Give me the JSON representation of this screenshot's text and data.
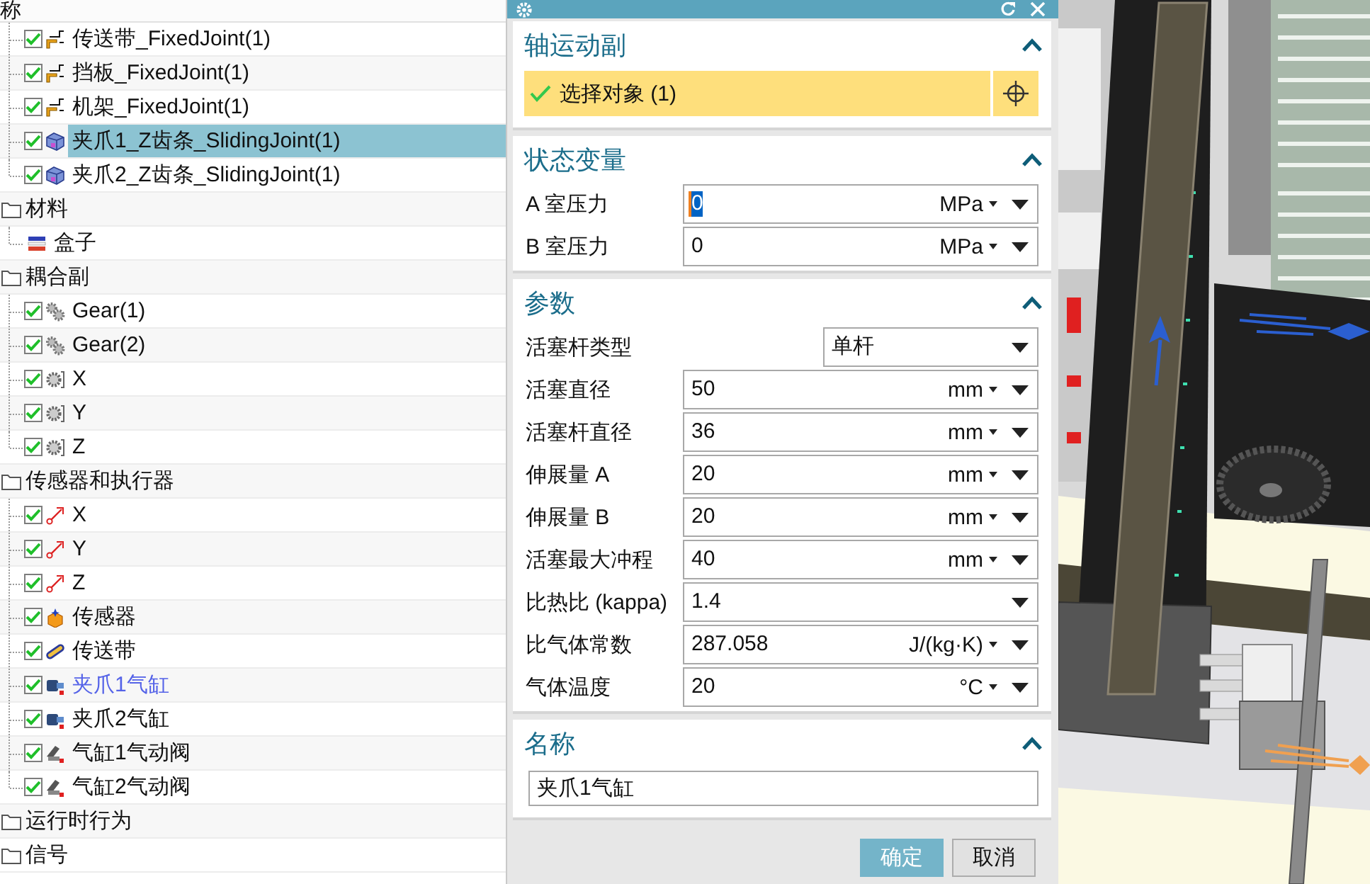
{
  "tree": {
    "column_header": "称",
    "nodes": [
      {
        "children": [
          {
            "label": "传送带_FixedJoint(1)",
            "kind": "fixed-joint",
            "checked": true,
            "selected": false,
            "editing": false
          },
          {
            "label": "挡板_FixedJoint(1)",
            "kind": "fixed-joint",
            "checked": true,
            "selected": false,
            "editing": false
          },
          {
            "label": "机架_FixedJoint(1)",
            "kind": "fixed-joint",
            "checked": true,
            "selected": false,
            "editing": false
          },
          {
            "label": "夹爪1_Z齿条_SlidingJoint(1)",
            "kind": "sliding-joint",
            "checked": true,
            "selected": true,
            "editing": false
          },
          {
            "label": "夹爪2_Z齿条_SlidingJoint(1)",
            "kind": "sliding-joint",
            "checked": true,
            "selected": false,
            "editing": false
          }
        ]
      },
      {
        "label": "材料",
        "kind": "folder",
        "selected": false,
        "editing": false,
        "children": [
          {
            "label": "盒子",
            "kind": "material",
            "selected": false,
            "editing": false
          }
        ]
      },
      {
        "label": "耦合副",
        "kind": "folder",
        "selected": false,
        "editing": false,
        "children": [
          {
            "label": "Gear(1)",
            "kind": "gear-pair",
            "checked": true,
            "selected": false,
            "editing": false
          },
          {
            "label": "Gear(2)",
            "kind": "gear-pair",
            "checked": true,
            "selected": false,
            "editing": false
          },
          {
            "label": "X",
            "kind": "gear",
            "checked": true,
            "selected": false,
            "editing": false
          },
          {
            "label": "Y",
            "kind": "gear",
            "checked": true,
            "selected": false,
            "editing": false
          },
          {
            "label": "Z",
            "kind": "gear",
            "checked": true,
            "selected": false,
            "editing": false
          }
        ]
      },
      {
        "label": "传感器和执行器",
        "kind": "folder",
        "selected": false,
        "editing": false,
        "children": [
          {
            "label": "X",
            "kind": "position",
            "checked": true,
            "selected": false,
            "editing": false
          },
          {
            "label": "Y",
            "kind": "position",
            "checked": true,
            "selected": false,
            "editing": false
          },
          {
            "label": "Z",
            "kind": "position",
            "checked": true,
            "selected": false,
            "editing": false
          },
          {
            "label": "传感器",
            "kind": "sensor",
            "checked": true,
            "selected": false,
            "editing": false
          },
          {
            "label": "传送带",
            "kind": "conveyor",
            "checked": true,
            "selected": false,
            "editing": false
          },
          {
            "label": "夹爪1气缸",
            "kind": "cylinder",
            "checked": true,
            "selected": false,
            "editing": true
          },
          {
            "label": "夹爪2气缸",
            "kind": "cylinder",
            "checked": true,
            "selected": false,
            "editing": false
          },
          {
            "label": "气缸1气动阀",
            "kind": "valve",
            "checked": true,
            "selected": false,
            "editing": false
          },
          {
            "label": "气缸2气动阀",
            "kind": "valve",
            "checked": true,
            "selected": false,
            "editing": false
          }
        ]
      },
      {
        "label": "运行时行为",
        "kind": "folder",
        "selected": false,
        "editing": false
      },
      {
        "label": "信号",
        "kind": "folder",
        "selected": false,
        "editing": false
      }
    ]
  },
  "dialog": {
    "sections": [
      {
        "kind": "selection",
        "title": "轴运动副",
        "expanded": true,
        "step": {
          "label": "选择对象 (1)",
          "done": true
        }
      },
      {
        "kind": "fields",
        "title": "状态变量",
        "expanded": true,
        "fields": [
          {
            "kind": "number",
            "label": "A 室压力",
            "value": "0",
            "unit": "MPa",
            "focused": true
          },
          {
            "kind": "number",
            "label": "B 室压力",
            "value": "0",
            "unit": "MPa",
            "focused": false
          }
        ]
      },
      {
        "kind": "fields",
        "title": "参数",
        "expanded": true,
        "fields": [
          {
            "kind": "select",
            "label": "活塞杆类型",
            "value": "单杆",
            "focused": false
          },
          {
            "kind": "number",
            "label": "活塞直径",
            "value": "50",
            "unit": "mm",
            "focused": false
          },
          {
            "kind": "number",
            "label": "活塞杆直径",
            "value": "36",
            "unit": "mm",
            "focused": false
          },
          {
            "kind": "number",
            "label": "伸展量 A",
            "value": "20",
            "unit": "mm",
            "focused": false
          },
          {
            "kind": "number",
            "label": "伸展量 B",
            "value": "20",
            "unit": "mm",
            "focused": false
          },
          {
            "kind": "number",
            "label": "活塞最大冲程",
            "value": "40",
            "unit": "mm",
            "focused": false
          },
          {
            "kind": "number",
            "label": "比热比 (kappa)",
            "value": "1.4",
            "focused": false
          },
          {
            "kind": "number",
            "label": "比气体常数",
            "value": "287.058",
            "unit": "J/(kg·K)",
            "focused": false
          },
          {
            "kind": "number",
            "label": "气体温度",
            "value": "20",
            "unit": "°C",
            "focused": false
          }
        ]
      },
      {
        "kind": "text",
        "title": "名称",
        "expanded": true,
        "value": "夹爪1气缸"
      }
    ],
    "buttons": [
      {
        "kind": "ok",
        "label": "确定"
      },
      {
        "kind": "cancel",
        "label": "取消"
      }
    ]
  }
}
